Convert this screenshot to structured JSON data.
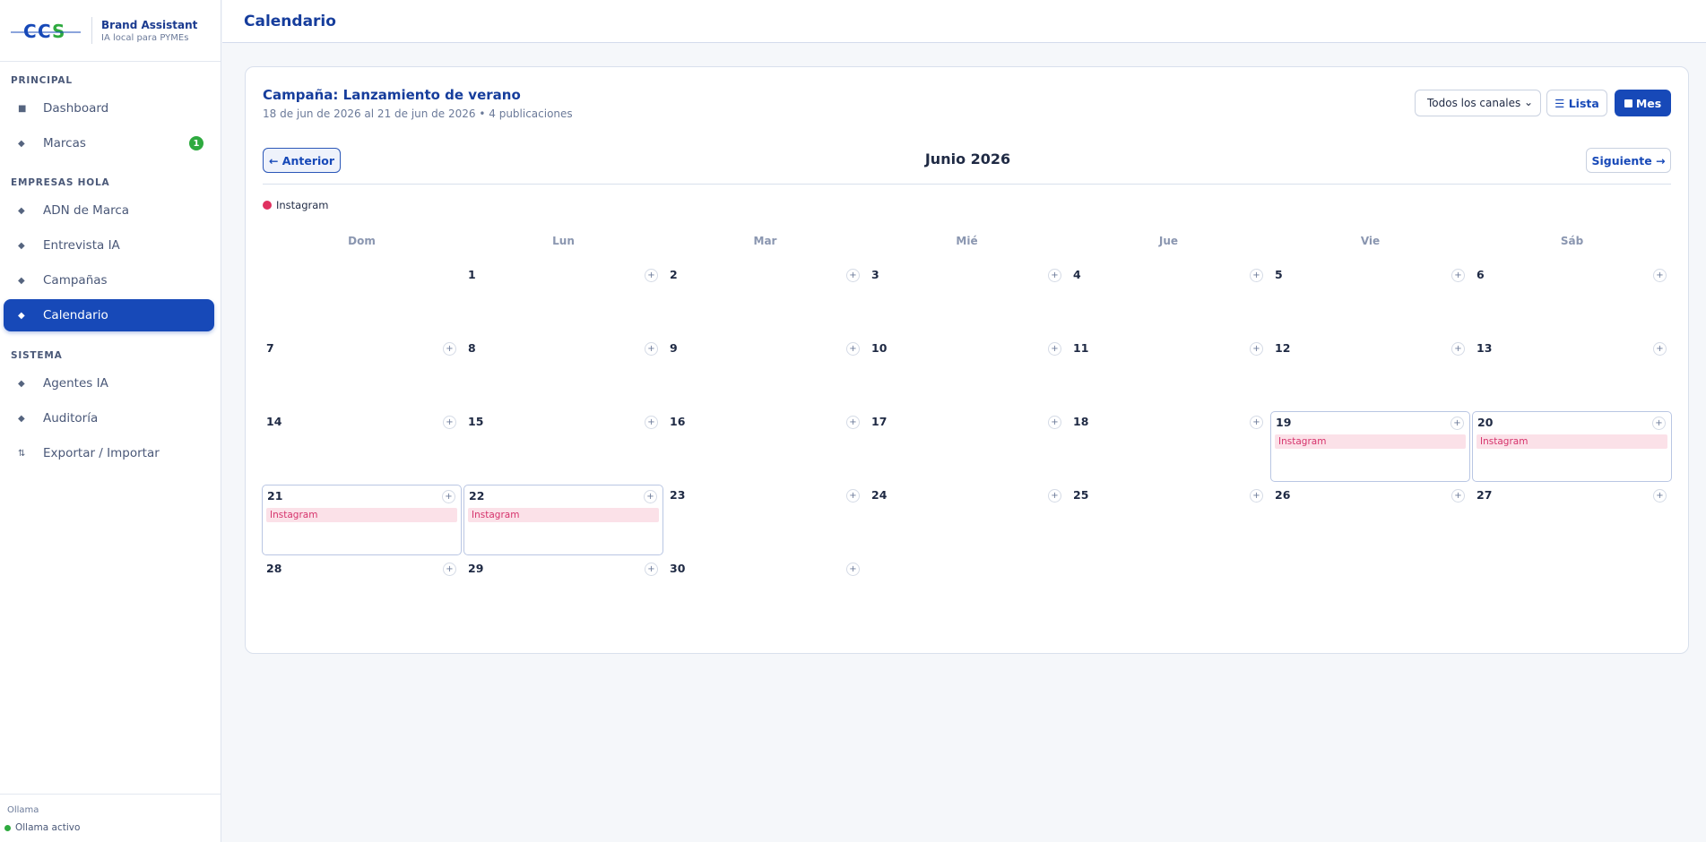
{
  "brand": {
    "name": "Brand Assistant",
    "tagline": "IA local para PYMEs",
    "logo_text": "CCS"
  },
  "sidebar": {
    "sections": [
      {
        "title": "PRINCIPAL"
      },
      {
        "title": "EMPRESAS HOLA"
      },
      {
        "title": "SISTEMA"
      }
    ],
    "items": [
      {
        "label": "Dashboard",
        "icon": "square-icon"
      },
      {
        "label": "Marcas",
        "icon": "diamond-icon",
        "badge": "1"
      },
      {
        "label": "ADN de Marca",
        "icon": "diamond-icon"
      },
      {
        "label": "Entrevista IA",
        "icon": "diamond-icon"
      },
      {
        "label": "Campañas",
        "icon": "diamond-icon"
      },
      {
        "label": "Calendario",
        "icon": "diamond-icon",
        "active": true
      },
      {
        "label": "Agentes IA",
        "icon": "diamond-icon"
      },
      {
        "label": "Auditoría",
        "icon": "diamond-icon"
      },
      {
        "label": "Exportar / Importar",
        "icon": "sort-arrows-icon"
      }
    ],
    "footer": {
      "label": "Ollama",
      "status": "Ollama activo",
      "status_color": "#2eaa3f"
    }
  },
  "header": {
    "title": "Calendario"
  },
  "campaign": {
    "title": "Campaña: Lanzamiento de verano",
    "subtitle": "18 de jun de 2026 al 21 de jun de 2026 • 4 publicaciones"
  },
  "controls": {
    "channel_select": "Todos los canales",
    "list_label": "☰ Lista",
    "month_label": "Mes",
    "prev_label": "← Anterior",
    "next_label": "Siguiente →",
    "month_title": "Junio 2026"
  },
  "legend": {
    "label": "Instagram",
    "color": "#e0305f"
  },
  "calendar": {
    "weekdays": [
      "Dom",
      "Lun",
      "Mar",
      "Mié",
      "Jue",
      "Vie",
      "Sáb"
    ],
    "first_weekday_index": 1,
    "days_in_month": 30,
    "events": [
      {
        "day": 19,
        "label": "Instagram"
      },
      {
        "day": 20,
        "label": "Instagram"
      },
      {
        "day": 21,
        "label": "Instagram"
      },
      {
        "day": 22,
        "label": "Instagram"
      }
    ],
    "add_symbol": "+"
  },
  "colors": {
    "accent": "#1749b8",
    "event_bg": "#fbe1e8",
    "event_text": "#d6336c"
  }
}
